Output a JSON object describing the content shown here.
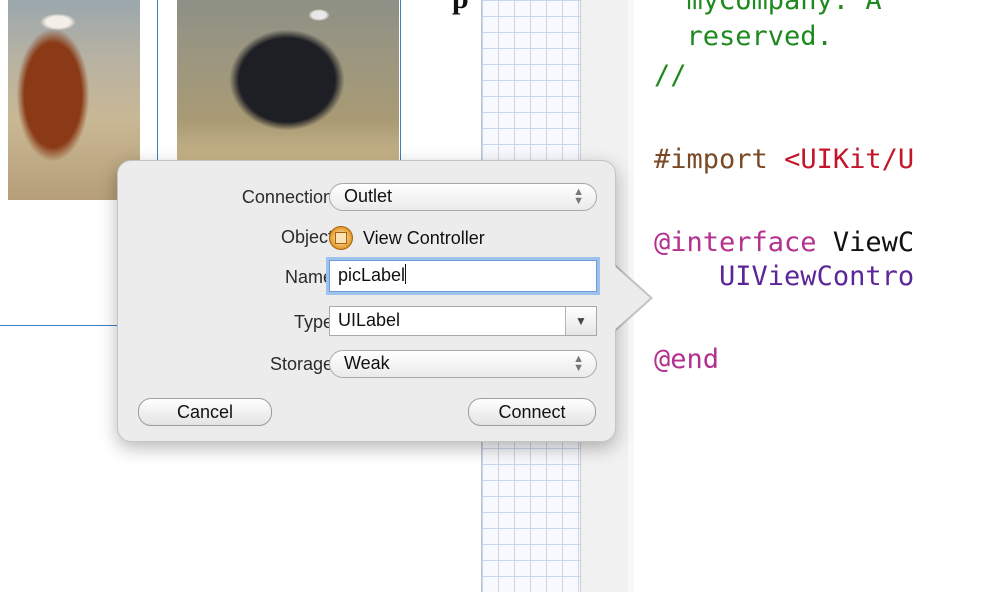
{
  "canvas": {
    "title_fragment": "p"
  },
  "editor": {
    "lines": [
      {
        "text": "  reserved.",
        "class": "c-comment"
      },
      {
        "text": "//",
        "class": "c-comment"
      }
    ],
    "import_directive": "#import",
    "import_target": "<UIKit/U",
    "interface_keyword": "@interface",
    "interface_name": "ViewC",
    "superclass_fragment": "UIViewContro",
    "end_keyword": "@end",
    "top_clipped_text": "  myCompany. A"
  },
  "popover": {
    "connection": {
      "label": "Connection",
      "value": "Outlet"
    },
    "object": {
      "label": "Object",
      "value": "View Controller",
      "icon": "view-controller-icon"
    },
    "name": {
      "label": "Name",
      "value": "picLabel"
    },
    "type": {
      "label": "Type",
      "value": "UILabel"
    },
    "storage": {
      "label": "Storage",
      "value": "Weak"
    },
    "cancel_label": "Cancel",
    "connect_label": "Connect"
  },
  "colors": {
    "comment": "#1e8a1e",
    "keyword": "#b4308f",
    "string": "#c4162b",
    "type": "#5c2699",
    "focus_ring": "#9ec2ef",
    "frame_line": "#3b7fc4"
  }
}
